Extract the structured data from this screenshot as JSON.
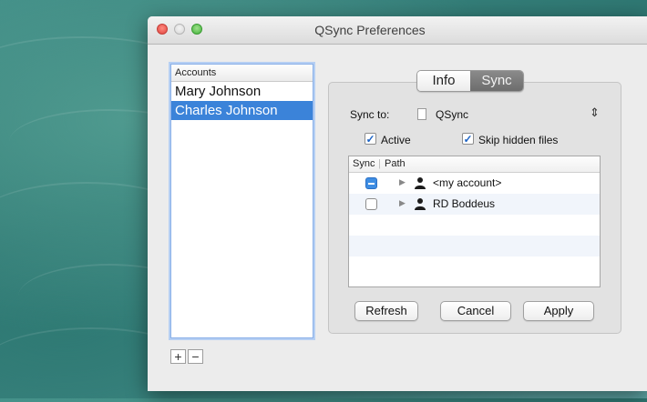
{
  "window": {
    "title": "QSync Preferences"
  },
  "accounts": {
    "header": "Accounts",
    "items": [
      "Mary Johnson",
      "Charles Johnson"
    ],
    "selected_index": 1,
    "add_label": "+",
    "remove_label": "−"
  },
  "tabs": {
    "info": "Info",
    "sync": "Sync",
    "active": "Sync"
  },
  "sync": {
    "sync_to_label": "Sync to:",
    "sync_to_value": "QSync",
    "active_label": "Active",
    "active_checked": true,
    "skip_hidden_label": "Skip hidden files",
    "skip_hidden_checked": true,
    "table": {
      "col_sync": "Sync",
      "col_path": "Path",
      "rows": [
        {
          "path": "<my account>",
          "state": "mixed"
        },
        {
          "path": "RD Boddeus",
          "state": "unchecked"
        }
      ]
    }
  },
  "buttons": {
    "refresh": "Refresh",
    "cancel": "Cancel",
    "apply": "Apply"
  },
  "colors": {
    "selection": "#3b83d9",
    "accent": "#3e8de3"
  }
}
